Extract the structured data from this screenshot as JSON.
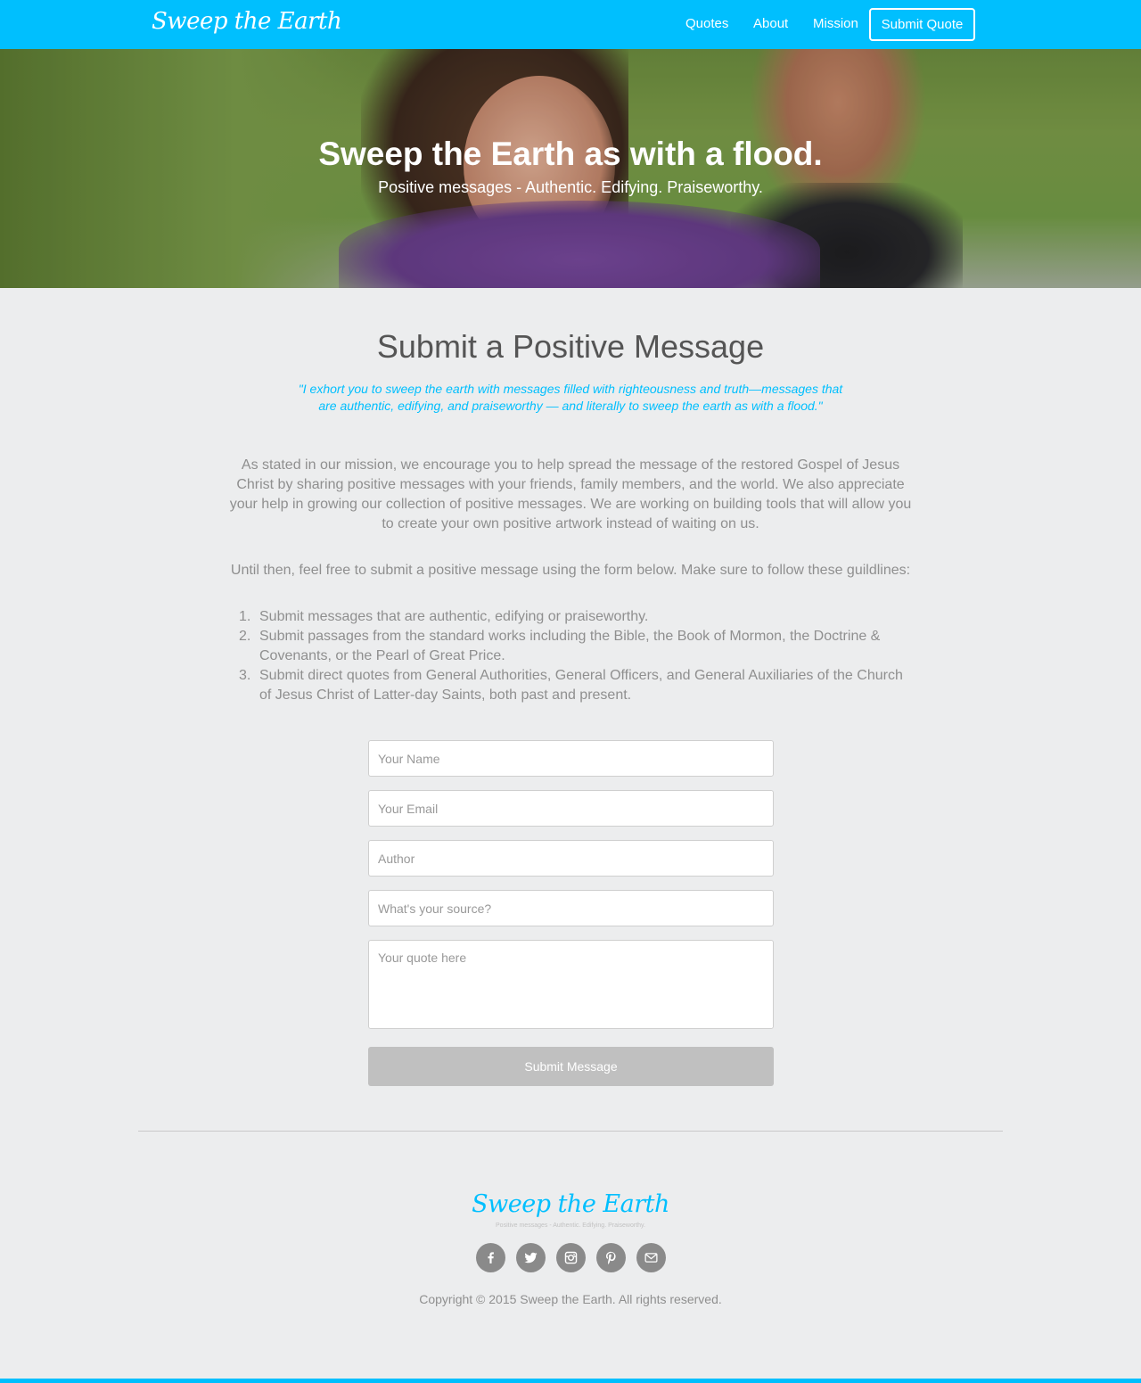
{
  "nav": {
    "brand": "Sweep the Earth",
    "links": [
      "Quotes",
      "About",
      "Mission"
    ],
    "cta": "Submit Quote"
  },
  "hero": {
    "title": "Sweep the Earth as with a flood.",
    "subtitle": "Positive messages - Authentic. Edifying. Praiseworthy."
  },
  "main": {
    "heading": "Submit a Positive Message",
    "quote": "\"I exhort you to sweep the earth with messages filled with righteousness and truth—messages that are authentic, edifying, and praiseworthy — and literally to sweep the earth as with a flood.\"",
    "paragraph1": "As stated in our mission, we encourage you to help spread the message of the restored Gospel of Jesus Christ by sharing positive messages with your friends, family members, and the world. We also appreciate your help in growing our collection of positive messages. We are working on building tools that will allow you to create your own positive artwork instead of waiting on us.",
    "paragraph2": "Until then, feel free to submit a positive message using the form below. Make sure to follow these guildlines:",
    "guidelines": [
      {
        "num": "1.",
        "text": "Submit messages that are authentic, edifying or praiseworthy."
      },
      {
        "num": "2.",
        "text": "Submit passages from the standard works including the Bible, the Book of Mormon, the Doctrine & Covenants, or the Pearl of Great Price."
      },
      {
        "num": "3.",
        "text": "Submit direct quotes from General Authorities, General Officers, and General Auxiliaries of the Church of Jesus Christ of Latter-day Saints, both past and present."
      }
    ]
  },
  "form": {
    "name_placeholder": "Your Name",
    "email_placeholder": "Your Email",
    "author_placeholder": "Author",
    "source_placeholder": "What's your source?",
    "quote_placeholder": "Your quote here",
    "submit_label": "Submit Message"
  },
  "footer": {
    "logo": "Sweep the Earth",
    "tagline": "Positive messages - Authentic. Edifying. Praiseworthy.",
    "socials": [
      "facebook-icon",
      "twitter-icon",
      "instagram-icon",
      "pinterest-icon",
      "email-icon"
    ],
    "copyright": "Copyright © 2015 Sweep the Earth. All rights reserved."
  },
  "colors": {
    "accent": "#00BFFE",
    "background": "#ECEDEE",
    "button_disabled": "#C0C0C0",
    "social_icon_bg": "#8A8A8A"
  }
}
